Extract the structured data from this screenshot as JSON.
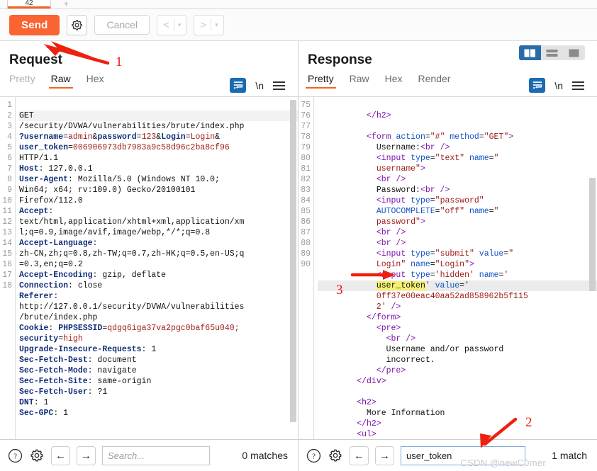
{
  "window": {
    "tab_label": "42",
    "new_tab_glyph": "+"
  },
  "toolbar": {
    "send_label": "Send",
    "settings_icon": "gear-icon",
    "cancel_label": "Cancel",
    "prev_glyph": "<",
    "next_glyph": ">",
    "caret_glyph": "▾"
  },
  "request": {
    "title": "Request",
    "tabs": [
      {
        "label": "Pretty",
        "active": false,
        "muted": true
      },
      {
        "label": "Raw",
        "active": true,
        "muted": false
      },
      {
        "label": "Hex",
        "active": false,
        "muted": false
      }
    ],
    "wrap_icon": "word-wrap-icon",
    "newline_label": "\\n",
    "menu_icon": "hamburger-menu-icon",
    "lines": [
      {
        "no": "1",
        "highlight": true
      },
      {
        "no": "2"
      },
      {
        "no": "3"
      },
      {
        "no": "4"
      },
      {
        "no": "5"
      },
      {
        "no": "6"
      },
      {
        "no": "7"
      },
      {
        "no": "8"
      },
      {
        "no": "9"
      },
      {
        "no": "10"
      },
      {
        "no": "11"
      },
      {
        "no": "12"
      },
      {
        "no": "13"
      },
      {
        "no": "14"
      },
      {
        "no": "15"
      },
      {
        "no": "16"
      },
      {
        "no": "17"
      },
      {
        "no": "18"
      }
    ],
    "body": {
      "method": "GET",
      "path": "/security/DVWA/vulnerabilities/brute/index.php",
      "query_params": [
        {
          "name": "?username",
          "value": "admin"
        },
        {
          "name": "password",
          "value": "123"
        },
        {
          "name": "Login",
          "value": "Login"
        },
        {
          "name": "user_token",
          "value": "006906973db7983a9c58d96c2ba8cf96"
        }
      ],
      "http_version": "HTTP/1.1",
      "headers": [
        {
          "name": "Host",
          "value": "127.0.0.1"
        },
        {
          "name": "User-Agent",
          "value": "Mozilla/5.0 (Windows NT 10.0; Win64; x64; rv:109.0) Gecko/20100101 Firefox/112.0"
        },
        {
          "name": "Accept",
          "value": "text/html,application/xhtml+xml,application/xml;q=0.9,image/avif,image/webp,*/*;q=0.8"
        },
        {
          "name": "Accept-Language",
          "value": "zh-CN,zh;q=0.8,zh-TW;q=0.7,zh-HK;q=0.5,en-US;q=0.3,en;q=0.2"
        },
        {
          "name": "Accept-Encoding",
          "value": "gzip, deflate"
        },
        {
          "name": "Connection",
          "value": "close"
        },
        {
          "name": "Referer",
          "value": "http://127.0.0.1/security/DVWA/vulnerabilities/brute/index.php"
        },
        {
          "name": "Cookie",
          "value": "PHPSESSID=qdgq6iga37va2pgc0baf65u040; security=high"
        },
        {
          "name": "Upgrade-Insecure-Requests",
          "value": "1"
        },
        {
          "name": "Sec-Fetch-Dest",
          "value": "document"
        },
        {
          "name": "Sec-Fetch-Mode",
          "value": "navigate"
        },
        {
          "name": "Sec-Fetch-Site",
          "value": "same-origin"
        },
        {
          "name": "Sec-Fetch-User",
          "value": "?1"
        },
        {
          "name": "DNT",
          "value": "1"
        },
        {
          "name": "Sec-GPC",
          "value": "1"
        }
      ]
    },
    "footer": {
      "help_icon": "question-mark-icon",
      "settings_icon": "gear-icon",
      "prev_icon": "arrow-left-icon",
      "next_icon": "arrow-right-icon",
      "search_value": "",
      "search_placeholder": "Search...",
      "matches_label": "0 matches"
    }
  },
  "response": {
    "title": "Response",
    "tabs": [
      {
        "label": "Pretty",
        "active": true
      },
      {
        "label": "Raw",
        "active": false
      },
      {
        "label": "Hex",
        "active": false
      },
      {
        "label": "Render",
        "active": false
      }
    ],
    "layout_buttons": [
      {
        "name": "split-vertical",
        "active": true
      },
      {
        "name": "split-horizontal",
        "active": false
      },
      {
        "name": "single-pane",
        "active": false
      }
    ],
    "wrap_icon": "word-wrap-icon",
    "newline_label": "\\n",
    "menu_icon": "hamburger-menu-icon",
    "line_numbers": [
      "75",
      "76",
      "77",
      "78",
      "79",
      "80",
      "81",
      "82",
      "83",
      "84",
      "85",
      "86",
      "87",
      "88",
      "89",
      "90"
    ],
    "body_html": {
      "form_open": "<form action=\"#\" method=\"GET\">",
      "username_label": "Username:<br />",
      "username_input": "<input type=\"text\" name=\"username\">",
      "password_label": "Password:<br />",
      "password_input": "<input type=\"password\" AUTOCOMPLETE=\"off\" name=\"password\">",
      "submit_input": "<input type=\"submit\" value=\"Login\" name=\"Login\">",
      "hidden_input_prefix": "<input type='hidden' name='",
      "hidden_input_token_name": "user_token",
      "hidden_input_value_attr": "' value='",
      "hidden_input_token_value": "0ff37e00eac40aa52ad858962b5f1152",
      "hidden_input_suffix": "' />",
      "form_close": "</form>",
      "pre_message": "Username and/or password incorrect.",
      "div_close": "</div>",
      "h2_text": "More Information"
    },
    "footer": {
      "help_icon": "question-mark-icon",
      "settings_icon": "gear-icon",
      "prev_icon": "arrow-left-icon",
      "next_icon": "arrow-right-icon",
      "search_value": "user_token",
      "search_placeholder": "",
      "matches_label": "1 match"
    }
  },
  "annotations": [
    {
      "id": "1",
      "label": "1",
      "points_to": "send-button"
    },
    {
      "id": "2",
      "label": "2",
      "points_to": "response-search-input"
    },
    {
      "id": "3",
      "label": "3",
      "points_to": "response-user-token-value"
    }
  ],
  "watermark": "CSDN @newC0mer",
  "colors": {
    "accent_orange": "#f96432",
    "annotation_red": "#e8180c",
    "highlight_yellow": "#f5f071",
    "selected_blue": "#1c6bb0"
  }
}
